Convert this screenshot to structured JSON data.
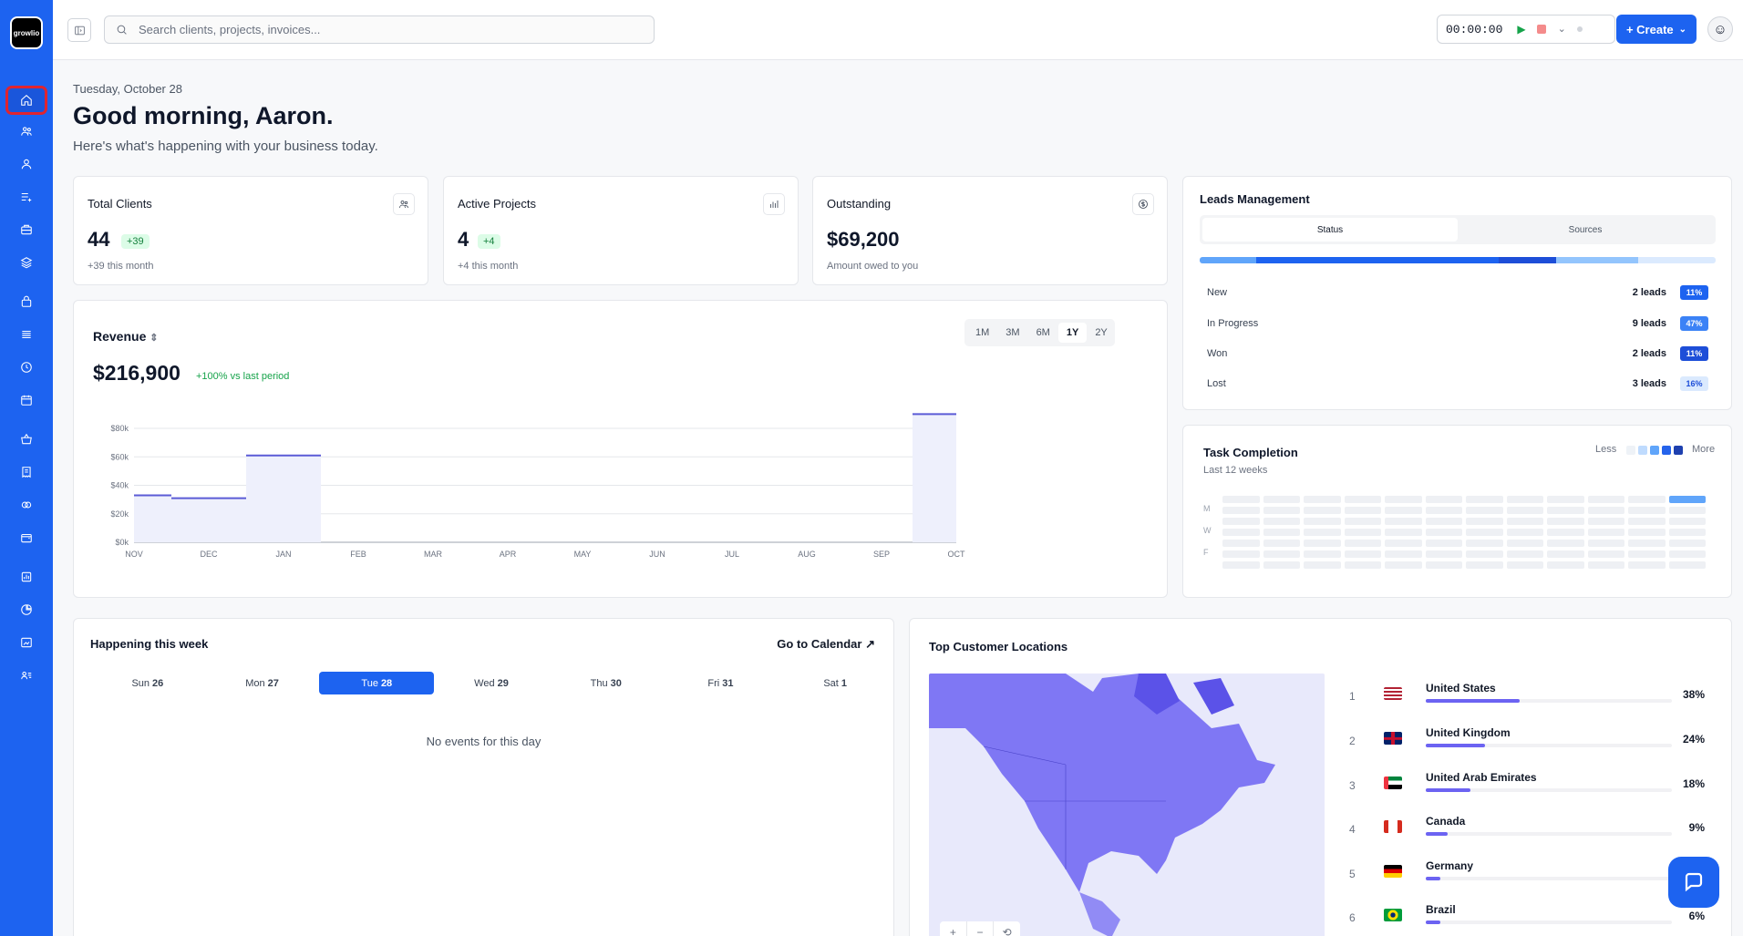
{
  "brand": {
    "logo_text": "growlio"
  },
  "topbar": {
    "search_placeholder": "Search clients, projects, invoices...",
    "timer": "00:00:00",
    "create_label": "+ Create"
  },
  "header": {
    "date": "Tuesday, October 28",
    "greeting": "Good morning, Aaron.",
    "subtitle": "Here's what's happening with your business today."
  },
  "stats": {
    "clients": {
      "title": "Total Clients",
      "value": "44",
      "badge": "+39",
      "note": "+39 this month"
    },
    "projects": {
      "title": "Active Projects",
      "value": "4",
      "badge": "+4",
      "note": "+4 this month"
    },
    "outstanding": {
      "title": "Outstanding",
      "value": "$69,200",
      "note": "Amount owed to you"
    }
  },
  "revenue": {
    "title": "Revenue",
    "value": "$216,900",
    "delta": "+100% vs last period",
    "periods": [
      "1M",
      "3M",
      "6M",
      "1Y",
      "2Y"
    ],
    "active_period": "1Y"
  },
  "chart_data": {
    "type": "area",
    "categories": [
      "NOV",
      "DEC",
      "JAN",
      "FEB",
      "MAR",
      "APR",
      "MAY",
      "JUN",
      "JUL",
      "AUG",
      "SEP",
      "OCT"
    ],
    "values": [
      33000,
      31000,
      61000,
      0,
      0,
      0,
      0,
      0,
      0,
      0,
      0,
      90000
    ],
    "y_ticks": [
      "$0k",
      "$20k",
      "$40k",
      "$60k",
      "$80k"
    ],
    "ylim": [
      0,
      80000
    ],
    "color": "#5b5bd6"
  },
  "leads": {
    "title": "Leads Management",
    "tabs": [
      "Status",
      "Sources"
    ],
    "rows": [
      {
        "name": "New",
        "count": "2 leads",
        "pct": "11%",
        "color": "#1d63f0",
        "text": "#ffffff",
        "share": 0.11
      },
      {
        "name": "In Progress",
        "count": "9 leads",
        "pct": "47%",
        "color": "#3b82f6",
        "text": "#ffffff",
        "share": 0.47
      },
      {
        "name": "Won",
        "count": "2 leads",
        "pct": "11%",
        "color": "#1d4ed8",
        "text": "#ffffff",
        "share": 0.11
      },
      {
        "name": "Lost",
        "count": "3 leads",
        "pct": "16%",
        "color": "#dbeafe",
        "text": "#1d4ed8",
        "share": 0.16
      }
    ]
  },
  "tasks": {
    "title": "Task Completion",
    "subtitle": "Last 12 weeks",
    "legend_less": "Less",
    "legend_more": "More",
    "legend_colors": [
      "#eef2f7",
      "#bfdbfe",
      "#60a5fa",
      "#2563eb",
      "#1e40af"
    ],
    "day_labels": [
      "M",
      "W",
      "F"
    ]
  },
  "week": {
    "title": "Happening this week",
    "link": "Go to Calendar",
    "days": [
      {
        "name": "Sun",
        "num": "26"
      },
      {
        "name": "Mon",
        "num": "27"
      },
      {
        "name": "Tue",
        "num": "28"
      },
      {
        "name": "Wed",
        "num": "29"
      },
      {
        "name": "Thu",
        "num": "30"
      },
      {
        "name": "Fri",
        "num": "31"
      },
      {
        "name": "Sat",
        "num": "1"
      }
    ],
    "active_day": "Tue",
    "empty": "No events for this day"
  },
  "locations": {
    "title": "Top Customer Locations",
    "items": [
      {
        "rank": "1",
        "name": "United States",
        "pct": "38%",
        "share": 0.38,
        "flag": "us"
      },
      {
        "rank": "2",
        "name": "United Kingdom",
        "pct": "24%",
        "share": 0.24,
        "flag": "uk"
      },
      {
        "rank": "3",
        "name": "United Arab Emirates",
        "pct": "18%",
        "share": 0.18,
        "flag": "ae"
      },
      {
        "rank": "4",
        "name": "Canada",
        "pct": "9%",
        "share": 0.09,
        "flag": "ca"
      },
      {
        "rank": "5",
        "name": "Germany",
        "pct": "",
        "share": 0.06,
        "flag": "de"
      },
      {
        "rank": "6",
        "name": "Brazil",
        "pct": "6%",
        "share": 0.06,
        "flag": "br"
      }
    ]
  }
}
